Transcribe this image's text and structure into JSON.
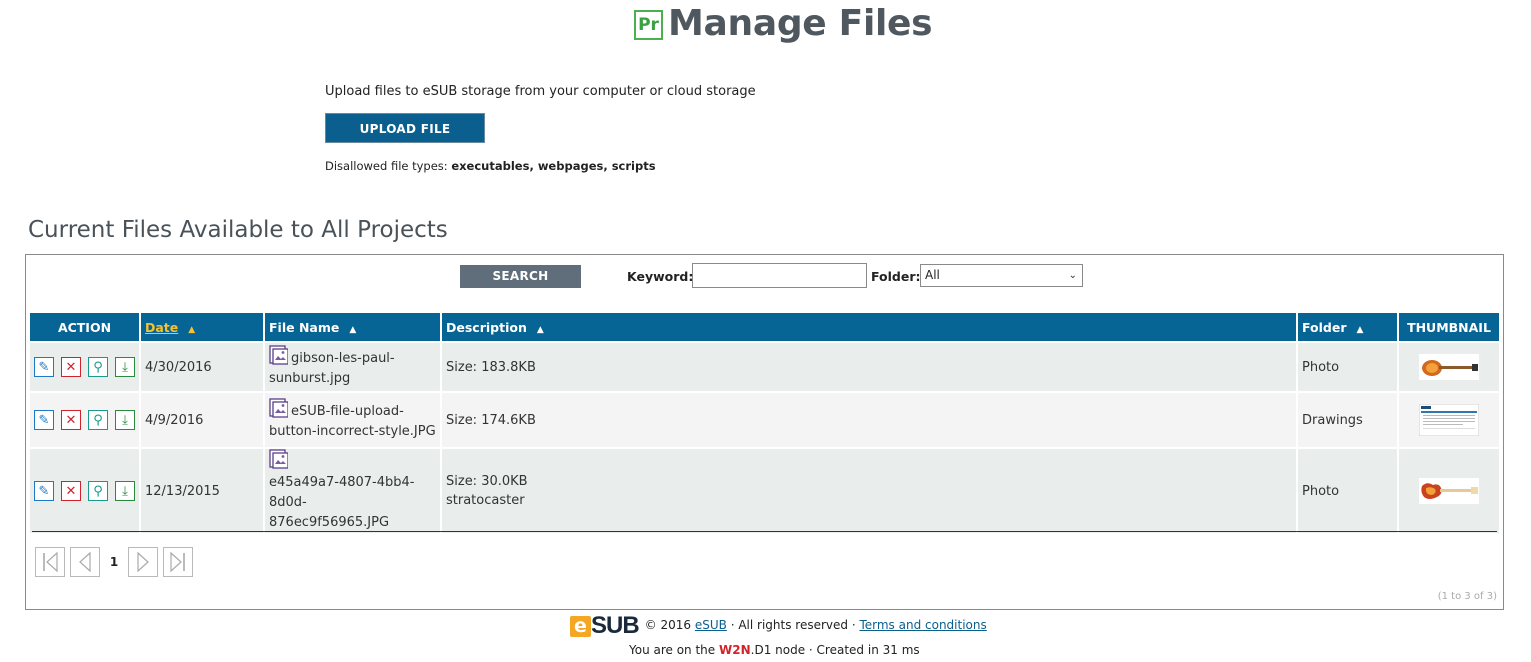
{
  "header": {
    "badge": "Pr",
    "title": "Manage Files"
  },
  "upload": {
    "description": "Upload files to eSUB storage from your computer or cloud storage",
    "button_label": "UPLOAD FILE",
    "disallowed_label": "Disallowed file types:",
    "disallowed_types": "executables, webpages, scripts"
  },
  "section": {
    "title": "Current Files Available to All Projects"
  },
  "search": {
    "button_label": "SEARCH",
    "keyword_label": "Keyword:",
    "keyword_value": "",
    "folder_label": "Folder:",
    "folder_selected": "All"
  },
  "table": {
    "columns": {
      "action": "ACTION",
      "date": "Date",
      "file_name": "File Name",
      "description": "Description",
      "folder": "Folder",
      "thumbnail": "THUMBNAIL"
    },
    "sort_column": "Date",
    "rows": [
      {
        "date": "4/30/2016",
        "file_name_1": "gibson-les-paul-",
        "file_name_2": "sunburst.jpg",
        "size": "Size: 183.8KB",
        "note": "",
        "folder": "Photo",
        "thumb": "guitar-les-paul"
      },
      {
        "date": "4/9/2016",
        "file_name_1": "eSUB-file-upload-",
        "file_name_2": "button-incorrect-style.JPG",
        "size": "Size: 174.6KB",
        "note": "",
        "folder": "Drawings",
        "thumb": "screenshot"
      },
      {
        "date": "12/13/2015",
        "file_name_1": "e45a49a7-4807-4bb4-8d0d-",
        "file_name_2": "876ec9f56965.JPG",
        "size": "Size: 30.0KB",
        "note": "stratocaster",
        "folder": "Photo",
        "thumb": "guitar-stratocaster"
      }
    ]
  },
  "pager": {
    "current_page": "1",
    "range_text": "(1 to 3 of 3)"
  },
  "footer": {
    "logo_e": "e",
    "logo_sub": "SUB",
    "copyright": "© 2016",
    "company_link": "eSUB",
    "rights": "· All rights reserved ·",
    "terms_link": "Terms and conditions",
    "node_prefix": "You are on the",
    "node_name": "W2N",
    "node_suffix": ".D1 node ·  Created in 31 ms"
  },
  "colors": {
    "header_bar": "#076596",
    "upload_button": "#0b5f8f",
    "search_button": "#5f6e7a",
    "sort_active": "#f5c332"
  }
}
